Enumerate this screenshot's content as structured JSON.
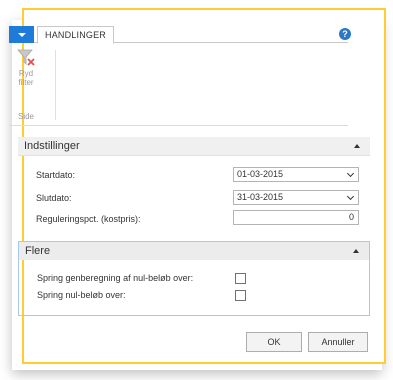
{
  "ribbon": {
    "tab_label": "HANDLINGER",
    "help_glyph": "?",
    "clear_filter_label": "Ryd filter",
    "group_label": "Side",
    "accent_color": "#1e7bd8"
  },
  "sections": {
    "settings": {
      "title": "Indstillinger",
      "start_date_label": "Startdato:",
      "start_date_value": "01-03-2015",
      "end_date_label": "Slutdato:",
      "end_date_value": "31-03-2015",
      "adjustment_label": "Reguleringspct. (kostpris):",
      "adjustment_value": "0"
    },
    "more": {
      "title": "Flere",
      "skip_recalc_label": "Spring genberegning af nul-beløb over:",
      "skip_recalc_checked": false,
      "skip_zero_label": "Spring nul-beløb over:",
      "skip_zero_checked": false
    }
  },
  "buttons": {
    "ok": "OK",
    "cancel": "Annuller"
  },
  "frame_color": "#ffcc33"
}
